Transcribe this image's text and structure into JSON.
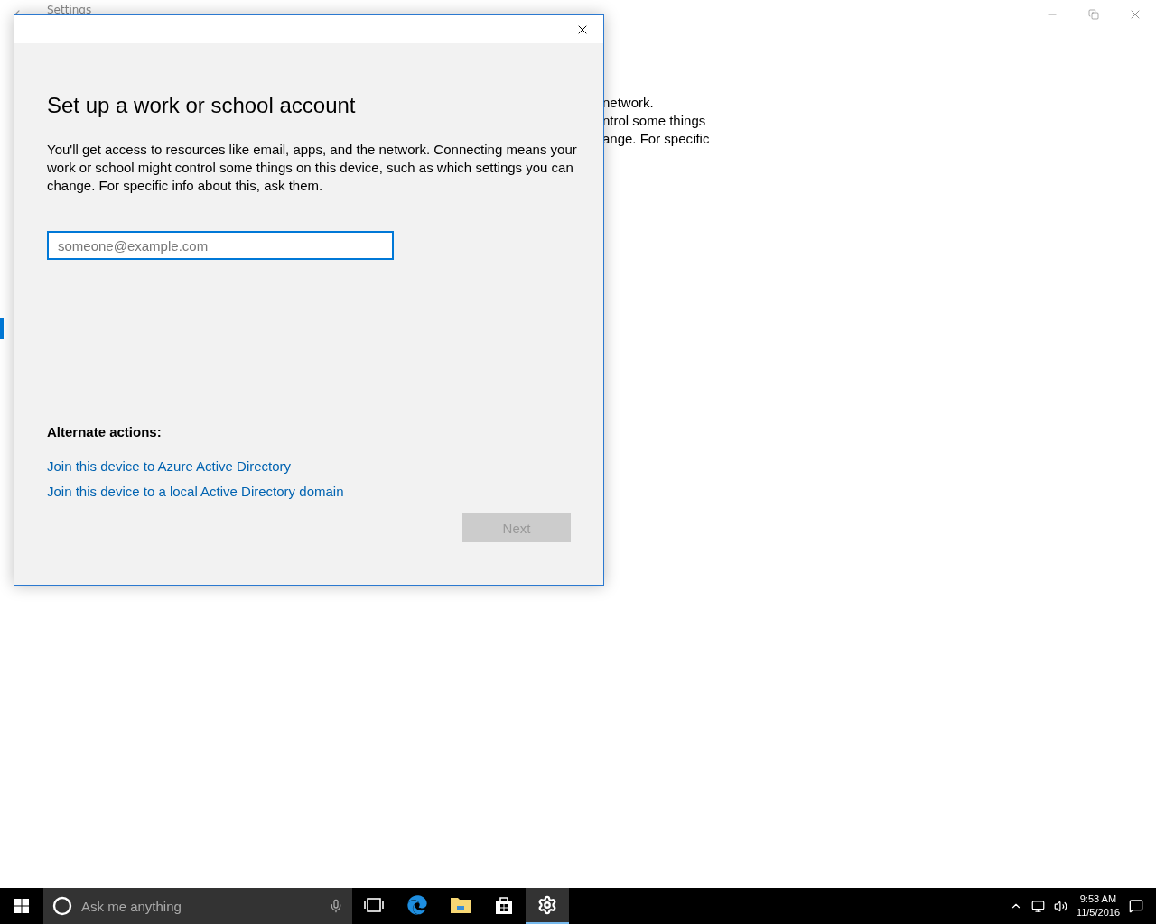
{
  "background_window": {
    "title": "Settings",
    "text_lines": [
      "network.",
      "ntrol some things",
      "ange. For specific"
    ]
  },
  "dialog": {
    "title": "Set up a work or school account",
    "description": "You'll get access to resources like email, apps, and the network. Connecting means your work or school might control some things on this device, such as which settings you can change. For specific info about this, ask them.",
    "email_field": {
      "placeholder": "someone@example.com"
    },
    "alternate_actions_label": "Alternate actions:",
    "links": [
      "Join this device to Azure Active Directory",
      "Join this device to a local Active Directory domain"
    ],
    "next_button": {
      "label": "Next",
      "disabled": true
    }
  },
  "taskbar": {
    "search": {
      "placeholder": "Ask me anything"
    },
    "apps": [
      {
        "kind": "task-view",
        "selected": false
      },
      {
        "kind": "browser",
        "selected": false
      },
      {
        "kind": "folder",
        "selected": false
      },
      {
        "kind": "store",
        "selected": false
      },
      {
        "kind": "settings",
        "selected": true
      }
    ],
    "clock": {
      "time": "9:53 AM",
      "date": "11/5/2016"
    }
  }
}
